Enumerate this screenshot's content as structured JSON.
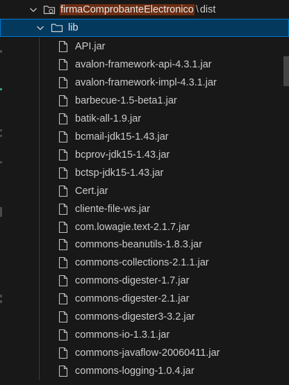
{
  "tree": {
    "root_folder": {
      "name_highlighted": "firmaComprobanteElectronico",
      "separator": "\\",
      "rest": "dist"
    },
    "sub_folder": {
      "name": "lib"
    },
    "files": [
      "API.jar",
      "avalon-framework-api-4.3.1.jar",
      "avalon-framework-impl-4.3.1.jar",
      "barbecue-1.5-beta1.jar",
      "batik-all-1.9.jar",
      "bcmail-jdk15-1.43.jar",
      "bcprov-jdk15-1.43.jar",
      "bctsp-jdk15-1.43.jar",
      "Cert.jar",
      "cliente-file-ws.jar",
      "com.lowagie.text-2.1.7.jar",
      "commons-beanutils-1.8.3.jar",
      "commons-collections-2.1.1.jar",
      "commons-digester-1.7.jar",
      "commons-digester-2.1.jar",
      "commons-digester3-3.2.jar",
      "commons-io-1.3.1.jar",
      "commons-javaflow-20060411.jar",
      "commons-logging-1.0.4.jar"
    ]
  },
  "icons": {
    "chevron": "chevron-down-icon",
    "folder": "folder-icon",
    "file": "file-icon"
  },
  "colors": {
    "background": "#181818",
    "selection": "#04395e",
    "selection_border": "#0078d4",
    "highlight": "#6b2d12",
    "text": "#cccccc"
  }
}
